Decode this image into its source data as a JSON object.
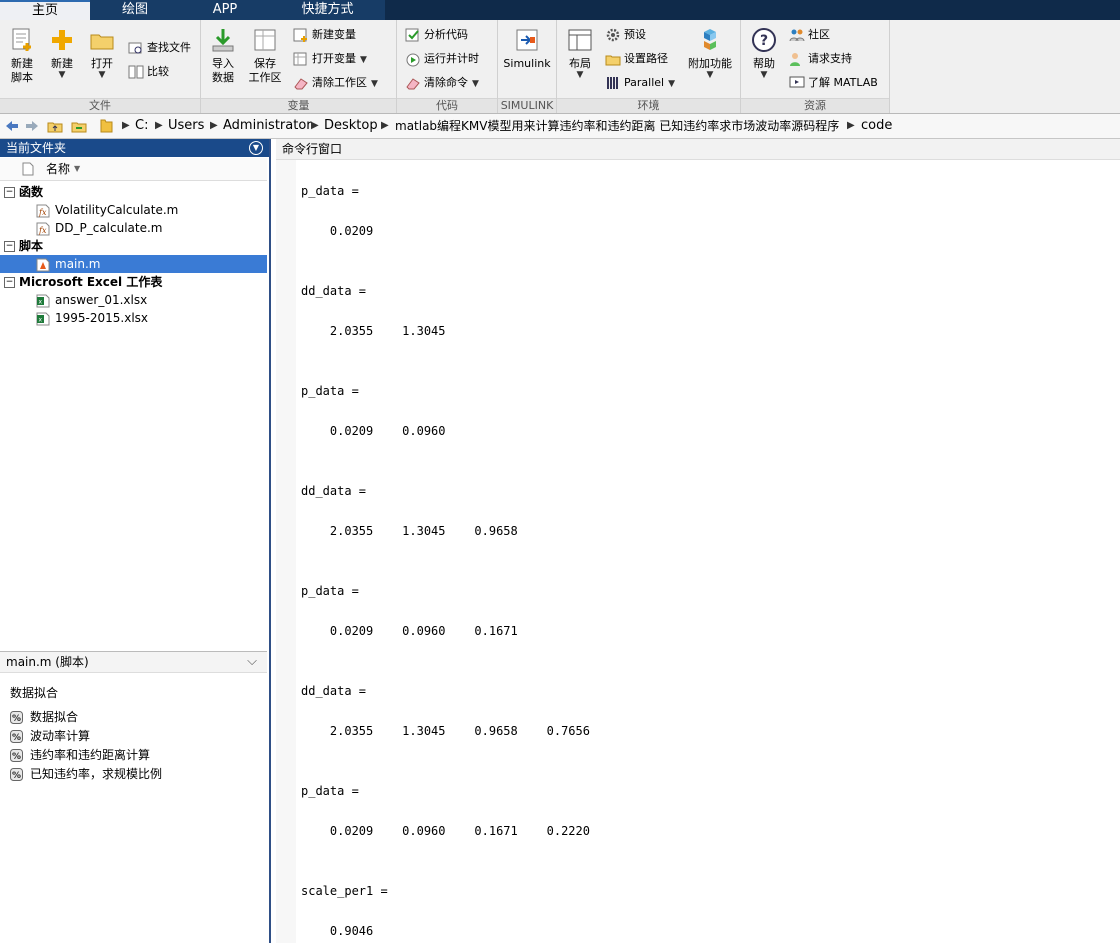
{
  "tabs": [
    "主页",
    "绘图",
    "APP",
    "快捷方式"
  ],
  "ribbon": {
    "file": {
      "label": "文件",
      "new_script": [
        "新建",
        "脚本"
      ],
      "new": "新建",
      "open": "打开",
      "find_files": "查找文件",
      "compare": "比较"
    },
    "variable": {
      "label": "变量",
      "import": [
        "导入",
        "数据"
      ],
      "save": [
        "保存",
        "工作区"
      ],
      "new_var": "新建变量",
      "open_var": "打开变量",
      "clear_ws": "清除工作区"
    },
    "code": {
      "label": "代码",
      "analyze": "分析代码",
      "run_time": "运行并计时",
      "clear_cmd": "清除命令"
    },
    "simulink": {
      "label": "SIMULINK",
      "btn": "Simulink"
    },
    "env": {
      "label": "环境",
      "layout": "布局",
      "prefs": "预设",
      "set_path": "设置路径",
      "parallel": "Parallel",
      "addons": "附加功能"
    },
    "resources": {
      "label": "资源",
      "help": "帮助",
      "community": "社区",
      "support": "请求支持",
      "learn": "了解 MATLAB"
    }
  },
  "address": [
    "C:",
    "Users",
    "Administrator",
    "Desktop",
    "matlab编程KMV模型用来计算违约率和违约距离 已知违约率求市场波动率源码程序",
    "code"
  ],
  "current_folder": {
    "title": "当前文件夹",
    "name_col": "名称",
    "sections": [
      {
        "title": "函数",
        "files": [
          "VolatilityCalculate.m",
          "DD_P_calculate.m"
        ]
      },
      {
        "title": "脚本",
        "files": [
          "main.m"
        ]
      },
      {
        "title": "Microsoft Excel 工作表",
        "files": [
          "answer_01.xlsx",
          "1995-2015.xlsx"
        ]
      }
    ]
  },
  "details": {
    "header": "main.m  (脚本)",
    "title": "数据拟合",
    "cells": [
      "数据拟合",
      "波动率计算",
      "违约率和违约距离计算",
      "已知违约率，求规模比例"
    ]
  },
  "command_window": {
    "title": "命令行窗口",
    "lines": [
      "p_data =",
      "    0.0209",
      "dd_data =",
      "    2.0355    1.3045",
      "p_data =",
      "    0.0209    0.0960",
      "dd_data =",
      "    2.0355    1.3045    0.9658",
      "p_data =",
      "    0.0209    0.0960    0.1671",
      "dd_data =",
      "    2.0355    1.3045    0.9658    0.7656",
      "p_data =",
      "    0.0209    0.0960    0.1671    0.2220",
      "scale_per1 =",
      "    0.9046"
    ]
  },
  "colors": {
    "selection": "#3a7bd5",
    "panel_header": "#1a4a8a",
    "tabbar": "#0f2a4a"
  }
}
